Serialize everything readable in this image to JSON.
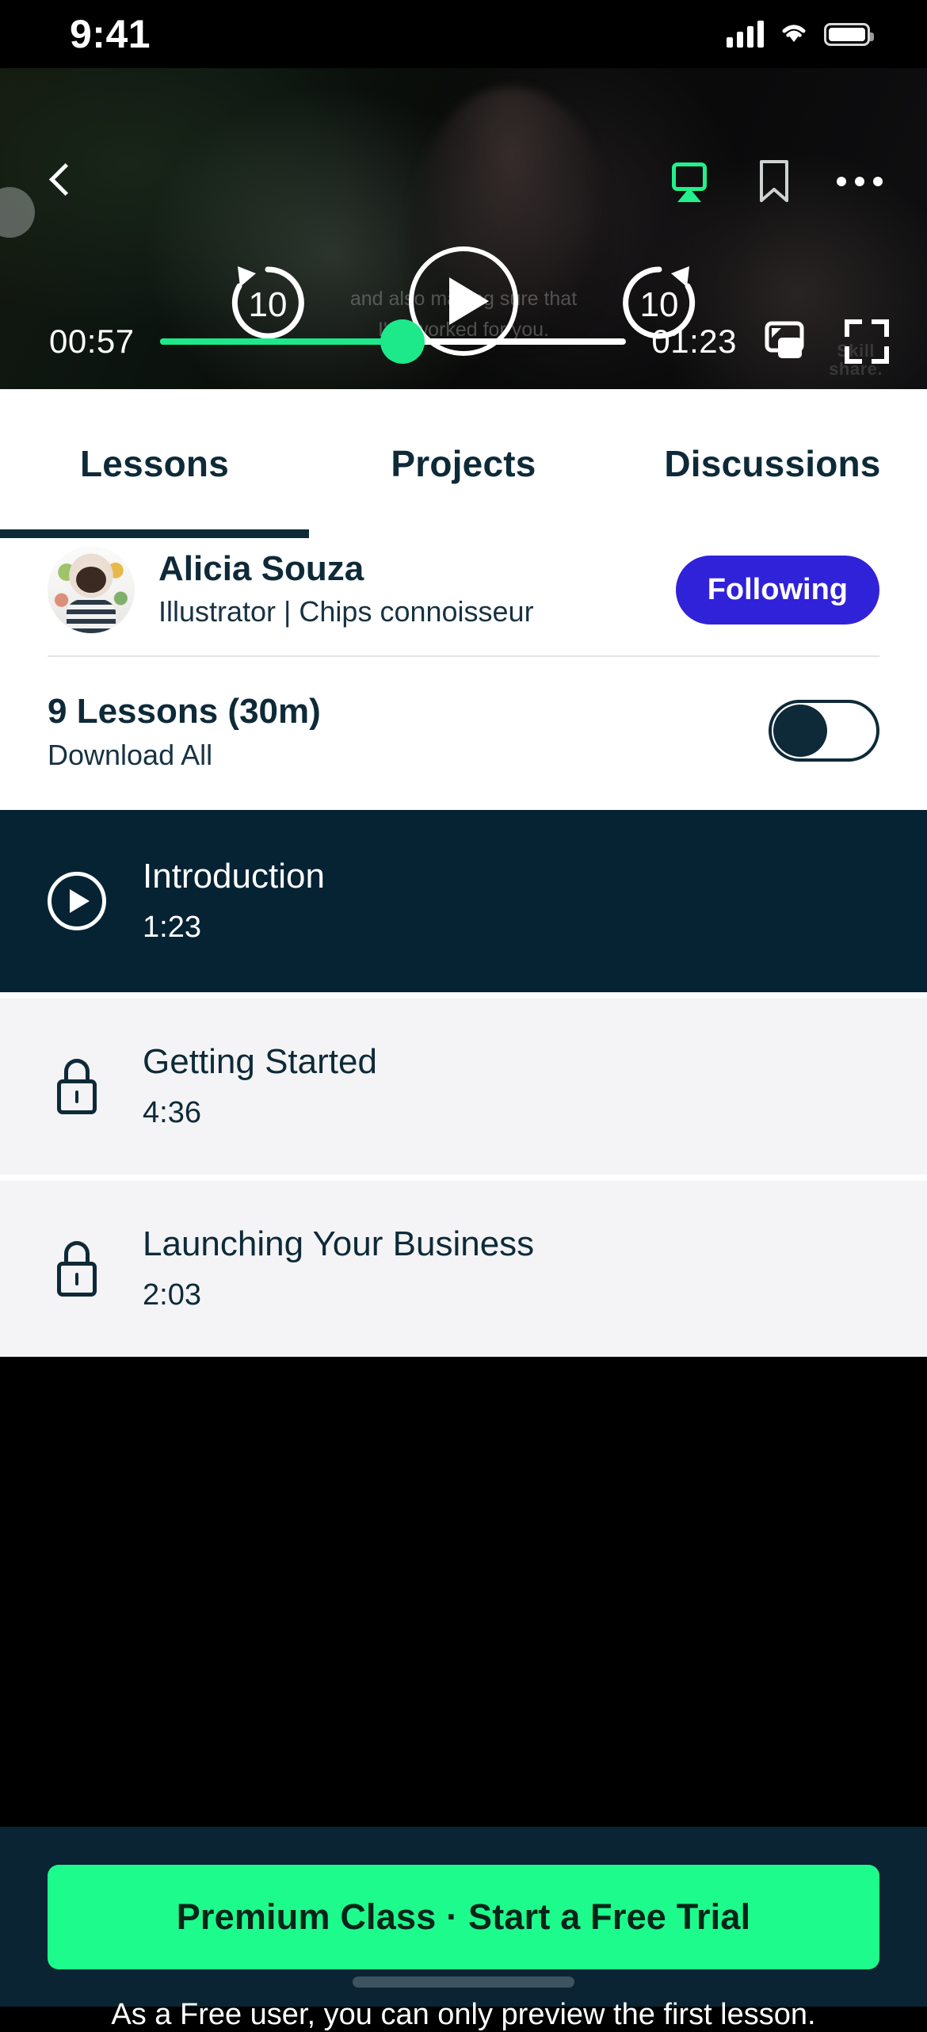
{
  "status_bar": {
    "time": "9:41",
    "icons": [
      "cellular-signal-icon",
      "wifi-icon",
      "battery-icon"
    ]
  },
  "player": {
    "back_icon": "back-chevron-icon",
    "cast_icon": "airplay-cast-icon",
    "cast_color": "#23f08a",
    "bookmark_icon": "bookmark-icon",
    "more_icon": "more-options-icon",
    "rewind_label": "10",
    "forward_label": "10",
    "play_icon": "play-icon",
    "current_time": "00:57",
    "total_time": "01:23",
    "progress_percent": 52,
    "progress_color": "#1de98b",
    "pip_icon": "picture-in-picture-icon",
    "fullscreen_icon": "fullscreen-icon",
    "subtitle_line1": "and also making sure that",
    "subtitle_line2": "I've worked for you.",
    "watermark_line1": "Skill",
    "watermark_line2": "share."
  },
  "tabs": {
    "items": [
      {
        "label": "Lessons",
        "active": true
      },
      {
        "label": "Projects",
        "active": false
      },
      {
        "label": "Discussions",
        "active": false
      }
    ],
    "active_color": "#0e2a38"
  },
  "author": {
    "avatar_icon": "avatar",
    "name": "Alicia Souza",
    "role": "Illustrator | Chips connoisseur",
    "follow_label": "Following",
    "follow_color": "#3022d8"
  },
  "download": {
    "title": "9 Lessons (30m)",
    "subtitle": "Download All",
    "toggle_icon": "download-all-toggle",
    "toggle_on": false
  },
  "lessons": [
    {
      "title": "Introduction",
      "duration": "1:23",
      "state": "active",
      "icon": "play-circle-icon"
    },
    {
      "title": "Getting Started",
      "duration": "4:36",
      "state": "locked",
      "icon": "lock-icon"
    },
    {
      "title": "Launching Your Business",
      "duration": "2:03",
      "state": "locked",
      "icon": "lock-icon"
    }
  ],
  "cta": {
    "button_label": "Premium Class · Start a Free Trial",
    "button_color": "#1efb8d",
    "note": "As a Free user, you can only preview the first lesson.",
    "bar_color": "#0a2433"
  }
}
